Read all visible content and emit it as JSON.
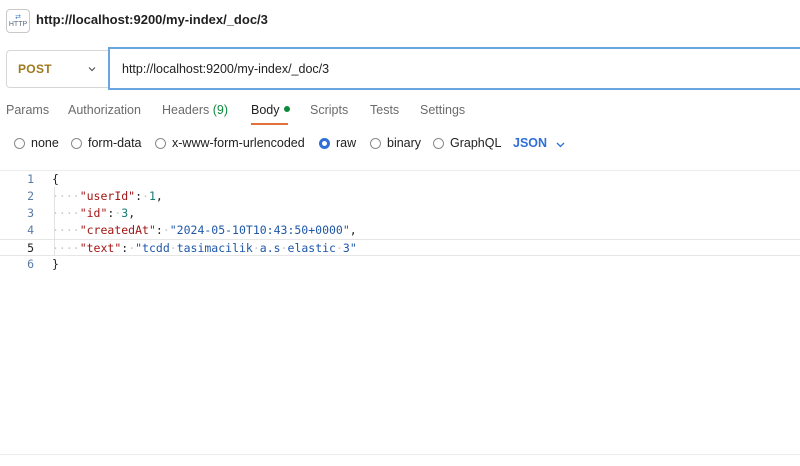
{
  "window": {
    "title": "http://localhost:9200/my-index/_doc/3",
    "icon": "http-icon",
    "icon_text": "HTTP"
  },
  "request": {
    "method": "POST",
    "url": "http://localhost:9200/my-index/_doc/3"
  },
  "tabs": [
    {
      "label": "Params"
    },
    {
      "label": "Authorization"
    },
    {
      "label": "Headers",
      "count": "(9)"
    },
    {
      "label": "Body",
      "active": true,
      "indicator": "green-dot"
    },
    {
      "label": "Scripts"
    },
    {
      "label": "Tests"
    },
    {
      "label": "Settings"
    }
  ],
  "body_types": [
    {
      "label": "none",
      "selected": false
    },
    {
      "label": "form-data",
      "selected": false
    },
    {
      "label": "x-www-form-urlencoded",
      "selected": false
    },
    {
      "label": "raw",
      "selected": true
    },
    {
      "label": "binary",
      "selected": false
    },
    {
      "label": "GraphQL",
      "selected": false
    }
  ],
  "raw_format": "JSON",
  "editor": {
    "current_line": 5,
    "lines": [
      {
        "n": "1",
        "text": "{"
      },
      {
        "n": "2",
        "key": "\"userId\"",
        "value": "1",
        "value_type": "number",
        "trail": ","
      },
      {
        "n": "3",
        "key": "\"id\"",
        "value": "3",
        "value_type": "number",
        "trail": ","
      },
      {
        "n": "4",
        "key": "\"createdAt\"",
        "value": "\"2024-05-10T10:43:50+0000\"",
        "value_type": "string",
        "trail": ","
      },
      {
        "n": "5",
        "key": "\"text\"",
        "value": "\"tcdd tasimacilik a.s elastic 3\"",
        "value_type": "string",
        "trail": ""
      },
      {
        "n": "6",
        "text": "}"
      }
    ]
  },
  "colors": {
    "method": "#a0781e",
    "active_tab_underline": "#e1713c",
    "count_and_dot": "#0c8a3c",
    "accent": "#2f6fd6",
    "json_key": "#a31515",
    "json_string": "#1e57a8",
    "json_number": "#127a72"
  }
}
